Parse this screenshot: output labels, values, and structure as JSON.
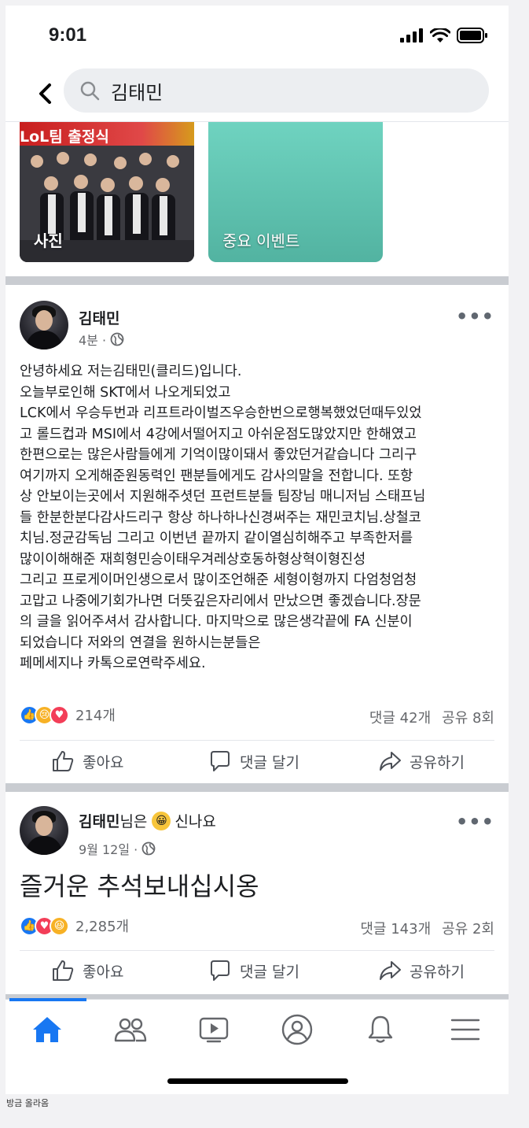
{
  "status_bar": {
    "time": "9:01"
  },
  "search": {
    "query": "김태민"
  },
  "tiles": [
    {
      "label": "사진",
      "banner": "LoL팀 출정식"
    },
    {
      "label": "중요 이벤트"
    }
  ],
  "posts": [
    {
      "author": "김태민",
      "time": "4분 ·",
      "lines": [
        "안녕하세요 저는김태민(클리드)입니다.",
        "오늘부로인해 SKT에서 나오게되었고",
        "LCK에서 우승두번과 리프트라이벌즈우승한번으로행복했었던때두있었",
        "고 롤드컵과 MSI에서 4강에서떨어지고 아쉬운점도많았지만 한해였고",
        "한편으로는 많은사람들에게 기억이많이돼서 좋았던거같습니다 그리구",
        "여기까지 오게해준원동력인 팬분들에게도 감사의말을 전합니다.  또항",
        "상 안보이는곳에서 지원해주셧던 프런트분들 팀장님 매니저님 스태프님",
        "들 한분한분다감사드리구 항상 하나하나신경써주는 재민코치님.상철코",
        "치님.정균감독님 그리고 이번년 끝까지 같이열심히해주고 부족한저를",
        "많이이해해준 재희형민승이태우겨레상호동하형상혁이형진성",
        "그리고 프로게이머인생으로서 많이조언해준 세형이형까지 다엄청엄청",
        "고맙고 나중에기회가나면 더뜻깊은자리에서 만났으면 좋겠습니다.장문",
        "의 글을 읽어주셔서 감사합니다. 마지막으로 많은생각끝에  FA 신분이",
        "되었습니다 저와의 연결을 원하시는분들은",
        "페메세지나 카톡으로연락주세요."
      ],
      "reaction_count": "214개",
      "comments": "댓글 42개",
      "shares": "공유 8회"
    },
    {
      "author": "김태민",
      "author_suffix": "님은",
      "feeling": "신나요",
      "time": "9월 12일 ·",
      "text": "즐거운 추석보내십시옹",
      "reaction_count": "2,285개",
      "comments": "댓글 143개",
      "shares": "공유 2회"
    }
  ],
  "actions": {
    "like": "좋아요",
    "comment": "댓글 달기",
    "share": "공유하기"
  },
  "caption": "방금 올라옴",
  "colors": {
    "accent": "#1877f2",
    "separator": "#c9ccd1",
    "event_tile": "#5fc4b0"
  }
}
